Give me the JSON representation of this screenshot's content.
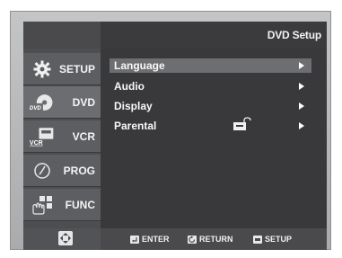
{
  "header": {
    "title": "DVD Setup"
  },
  "sidebar": {
    "items": [
      {
        "label": "SETUP",
        "icon": "gear-icon"
      },
      {
        "label": "DVD",
        "icon": "dvd-disc-icon",
        "icon_text": "DVD",
        "active": true
      },
      {
        "label": "VCR",
        "icon": "vcr-icon",
        "icon_text": "VCR"
      },
      {
        "label": "PROG",
        "icon": "clock-icon"
      },
      {
        "label": "FUNC",
        "icon": "function-grid-icon"
      }
    ]
  },
  "menu": {
    "items": [
      {
        "label": "Language",
        "selected": true
      },
      {
        "label": "Audio"
      },
      {
        "label": "Display"
      },
      {
        "label": "Parental",
        "locked": true
      }
    ]
  },
  "footer": {
    "enter_label": "ENTER",
    "return_label": "RETURN",
    "setup_label": "SETUP"
  },
  "colors": {
    "background": "#39393b",
    "sidebar": "#4d4e50",
    "selected_row": "#6d6e71",
    "frame": "#b5b7b8",
    "text": "#f8f8f8"
  }
}
